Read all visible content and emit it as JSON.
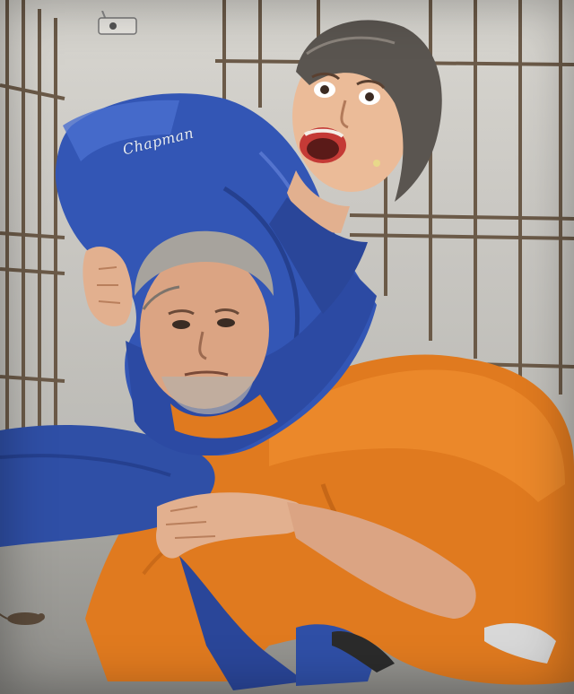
{
  "artwork": {
    "signature": "Chapman"
  },
  "colors": {
    "wall": "#cfcdc7",
    "bars": "#6b5a48",
    "blue_suit": "#2f4fa6",
    "orange_jumpsuit": "#e07a1f",
    "skin": "#e2b08f",
    "hair_dark": "#5a5550",
    "hair_grey": "#a7a39d"
  },
  "icons": {
    "camera": "security-camera-icon",
    "rat": "rat-icon"
  }
}
